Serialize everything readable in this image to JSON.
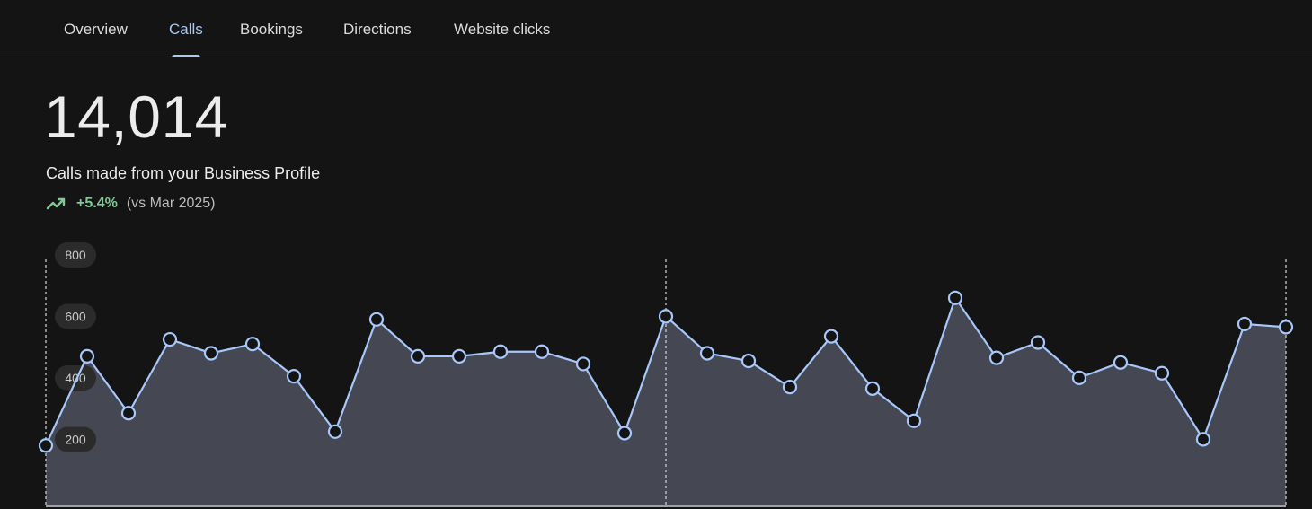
{
  "tabs": [
    {
      "label": "Overview",
      "active": false
    },
    {
      "label": "Calls",
      "active": true
    },
    {
      "label": "Bookings",
      "active": false
    },
    {
      "label": "Directions",
      "active": false
    },
    {
      "label": "Website clicks",
      "active": false
    }
  ],
  "summary": {
    "total": "14,014",
    "description": "Calls made from your Business Profile",
    "change": "+5.4%",
    "comparison": "(vs Mar 2025)"
  },
  "colors": {
    "line": "#a8c7fa",
    "area": "#454852",
    "positive": "#81c995",
    "background": "#141414"
  },
  "icons": {
    "trend": "trending-up-icon"
  },
  "chart_data": {
    "type": "area",
    "title": "",
    "xlabel": "",
    "ylabel": "",
    "ylim": [
      0,
      800
    ],
    "yticks": [
      "200",
      "400",
      "600",
      "800"
    ],
    "grid": false,
    "markers": true,
    "vertical_markers": [
      0,
      15,
      30
    ],
    "series": [
      {
        "values": [
          195,
          485,
          300,
          540,
          495,
          525,
          420,
          240,
          605,
          485,
          485,
          500,
          500,
          460,
          235,
          615,
          495,
          470,
          385,
          550,
          380,
          275,
          675,
          480,
          530,
          415,
          465,
          430,
          215,
          590,
          580
        ]
      }
    ]
  }
}
